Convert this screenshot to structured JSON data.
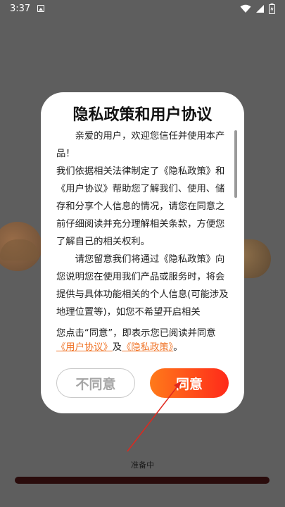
{
  "status_bar": {
    "time": "3:37"
  },
  "dialog": {
    "title": "隐私政策和用户协议",
    "paragraphs": [
      "亲爱的用户，欢迎您信任并使用本产品！",
      "我们依据相关法律制定了《隐私政策》和《用户协议》帮助您了解我们、使用、储存和分享个人信息的情况，请您在同意之前仔细阅读并充分理解相关条款，方便您了解自己的相关权利。",
      "请您留意我们将通过《隐私政策》向您说明您在使用我们产品或服务时，将会提供与具体功能相关的个人信息(可能涉及地理位置等)，如您不希望开启相关"
    ],
    "consent_prefix": "您点击“同意”，即表示您已阅读并同意",
    "consent_link_user": "《用户协议》",
    "consent_and": "及",
    "consent_link_privacy": "《隐私政策》",
    "consent_suffix": "。",
    "disagree_label": "不同意",
    "agree_label": "同意"
  },
  "loading": {
    "text": "准备中",
    "progress": 0.0
  },
  "colors": {
    "accent_orange": "#ff7a1a",
    "accent_red": "#ff2a1a",
    "link": "#f0762b",
    "arrow": "#e0281e"
  }
}
